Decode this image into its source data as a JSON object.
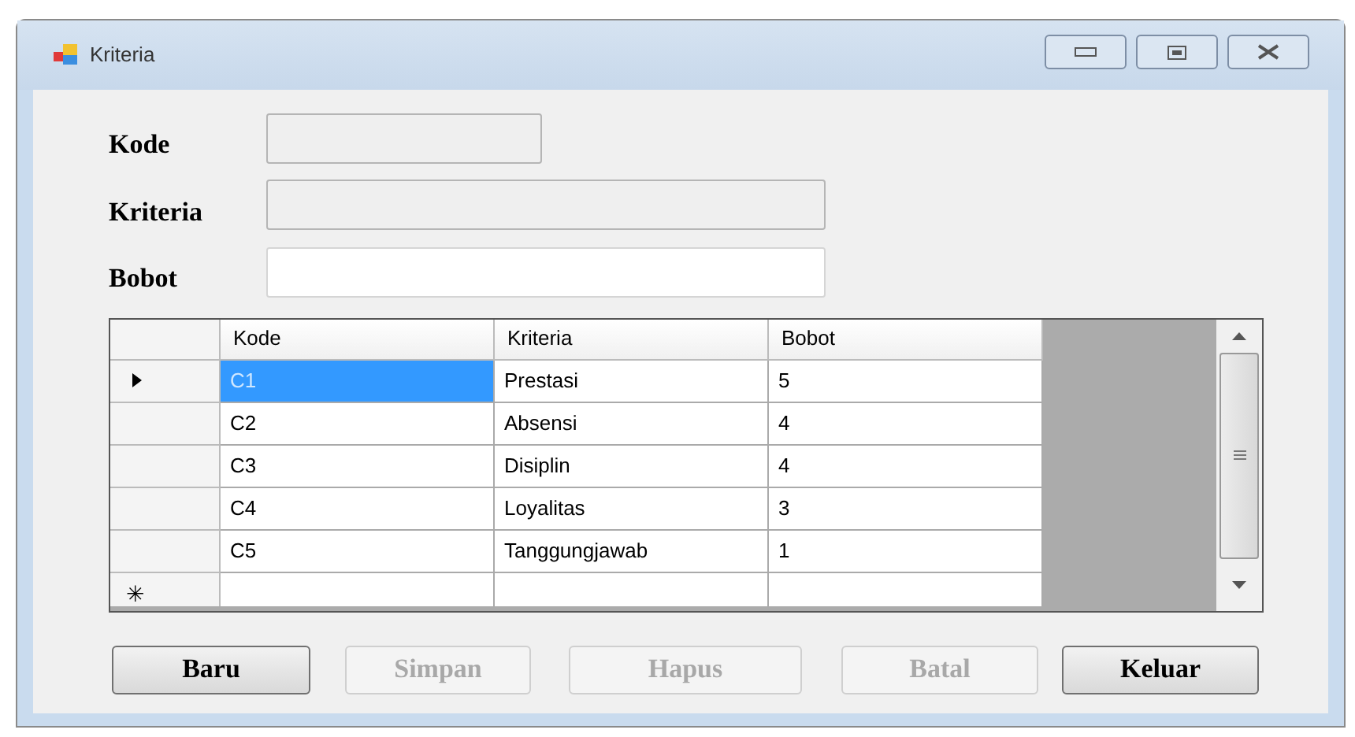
{
  "window": {
    "title": "Kriteria"
  },
  "fields": [
    {
      "label": "Kode",
      "disabled": true
    },
    {
      "label": "Kriteria",
      "disabled": true
    },
    {
      "label": "Bobot",
      "disabled": false
    }
  ],
  "table": {
    "columns": [
      "Kode",
      "Kriteria",
      "Bobot"
    ],
    "rows": [
      {
        "cells": [
          "C1",
          "Prestasi",
          "5"
        ],
        "current": true,
        "selected": true
      },
      {
        "cells": [
          "C2",
          "Absensi",
          "4"
        ],
        "current": false,
        "selected": false
      },
      {
        "cells": [
          "C3",
          "Disiplin",
          "4"
        ],
        "current": false,
        "selected": false
      },
      {
        "cells": [
          "C4",
          "Loyalitas",
          "3"
        ],
        "current": false,
        "selected": false
      },
      {
        "cells": [
          "C5",
          "Tanggungjawab",
          "1"
        ],
        "current": false,
        "selected": false
      }
    ],
    "new_row_marker": "✳"
  },
  "buttons": [
    {
      "label": "Baru",
      "disabled": false
    },
    {
      "label": "Simpan",
      "disabled": true
    },
    {
      "label": "Hapus",
      "disabled": true
    },
    {
      "label": "Batal",
      "disabled": true
    },
    {
      "label": "Keluar",
      "disabled": false
    }
  ]
}
